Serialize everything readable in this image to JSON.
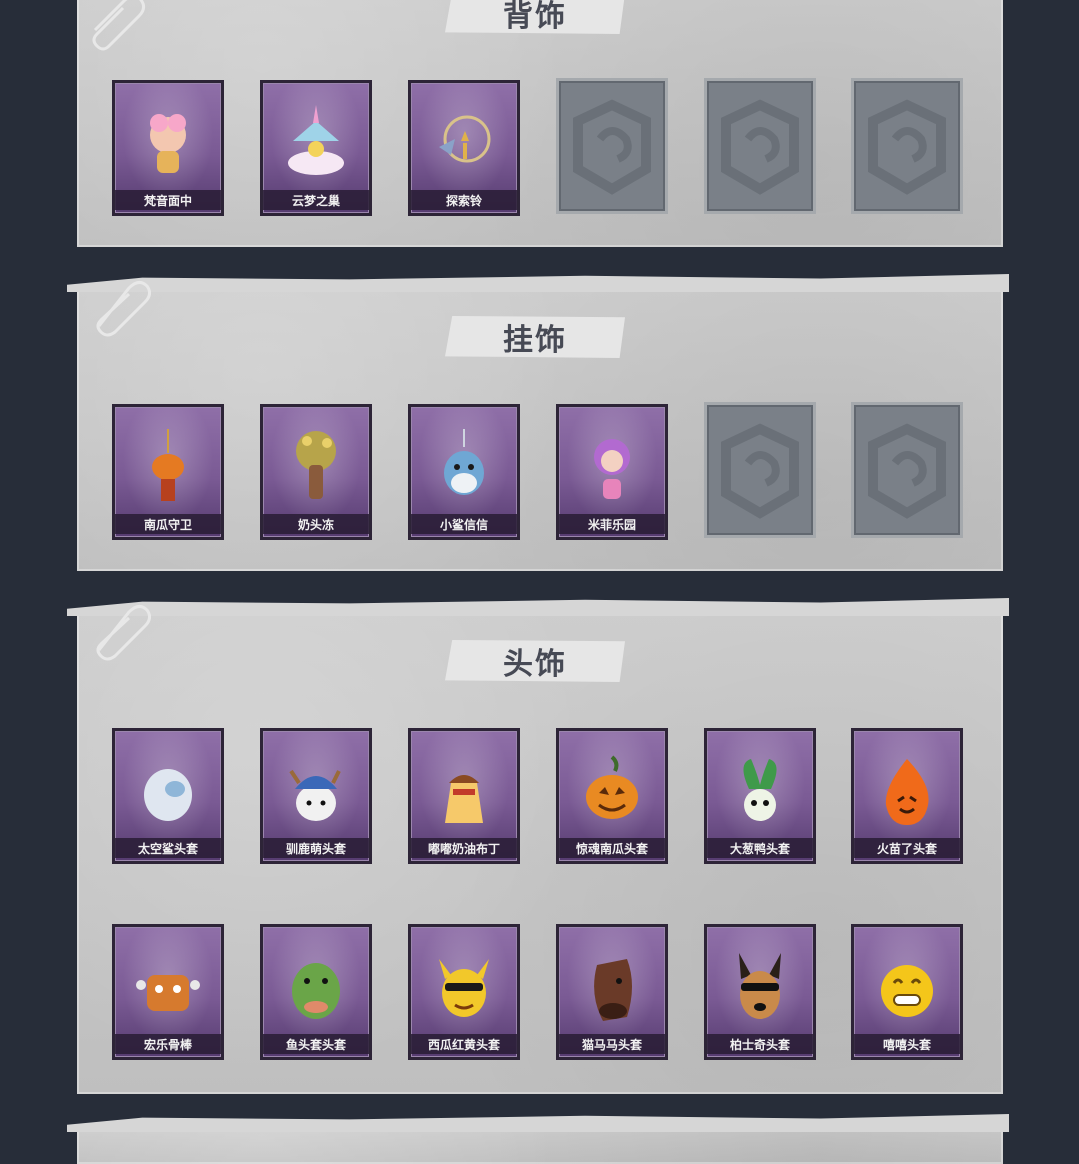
{
  "sections": [
    {
      "title": "背饰",
      "slots": [
        {
          "label": "梵音面中",
          "icon": "cherub-back-accessory-icon",
          "empty": false
        },
        {
          "label": "云梦之巢",
          "icon": "unicorn-nest-icon",
          "empty": false
        },
        {
          "label": "探索铃",
          "icon": "bell-wings-icon",
          "empty": false
        },
        {
          "label": "",
          "icon": "empty-slot-icon",
          "empty": true
        },
        {
          "label": "",
          "icon": "empty-slot-icon",
          "empty": true
        },
        {
          "label": "",
          "icon": "empty-slot-icon",
          "empty": true
        }
      ]
    },
    {
      "title": "挂饰",
      "slots": [
        {
          "label": "南瓜守卫",
          "icon": "pumpkin-guard-icon",
          "empty": false
        },
        {
          "label": "奶头冻",
          "icon": "tree-spirit-icon",
          "empty": false
        },
        {
          "label": "小鲨信信",
          "icon": "blue-shark-icon",
          "empty": false
        },
        {
          "label": "米菲乐园",
          "icon": "purple-doll-icon",
          "empty": false
        },
        {
          "label": "",
          "icon": "empty-slot-icon",
          "empty": true
        },
        {
          "label": "",
          "icon": "empty-slot-icon",
          "empty": true
        }
      ]
    },
    {
      "title": "头饰",
      "slots": [
        {
          "label": "太空鲨头套",
          "icon": "shark-egg-helmet-icon",
          "empty": false
        },
        {
          "label": "驯鹿萌头套",
          "icon": "reindeer-hat-icon",
          "empty": false
        },
        {
          "label": "嘟嘟奶油布丁",
          "icon": "pudding-head-icon",
          "empty": false
        },
        {
          "label": "惊魂南瓜头套",
          "icon": "pumpkin-head-icon",
          "empty": false
        },
        {
          "label": "大葱鸭头套",
          "icon": "scallion-head-icon",
          "empty": false
        },
        {
          "label": "火苗了头套",
          "icon": "fire-sprite-icon",
          "empty": false
        },
        {
          "label": "宏乐骨棒",
          "icon": "bone-biscuit-icon",
          "empty": false
        },
        {
          "label": "鱼头套头套",
          "icon": "frog-mask-icon",
          "empty": false
        },
        {
          "label": "西瓜红黄头套",
          "icon": "yellow-critter-icon",
          "empty": false
        },
        {
          "label": "猫马马头套",
          "icon": "horse-mask-icon",
          "empty": false
        },
        {
          "label": "柏士奇头套",
          "icon": "dog-head-icon",
          "empty": false
        },
        {
          "label": "嘻嘻头套",
          "icon": "grin-emoji-icon",
          "empty": false
        }
      ]
    }
  ]
}
